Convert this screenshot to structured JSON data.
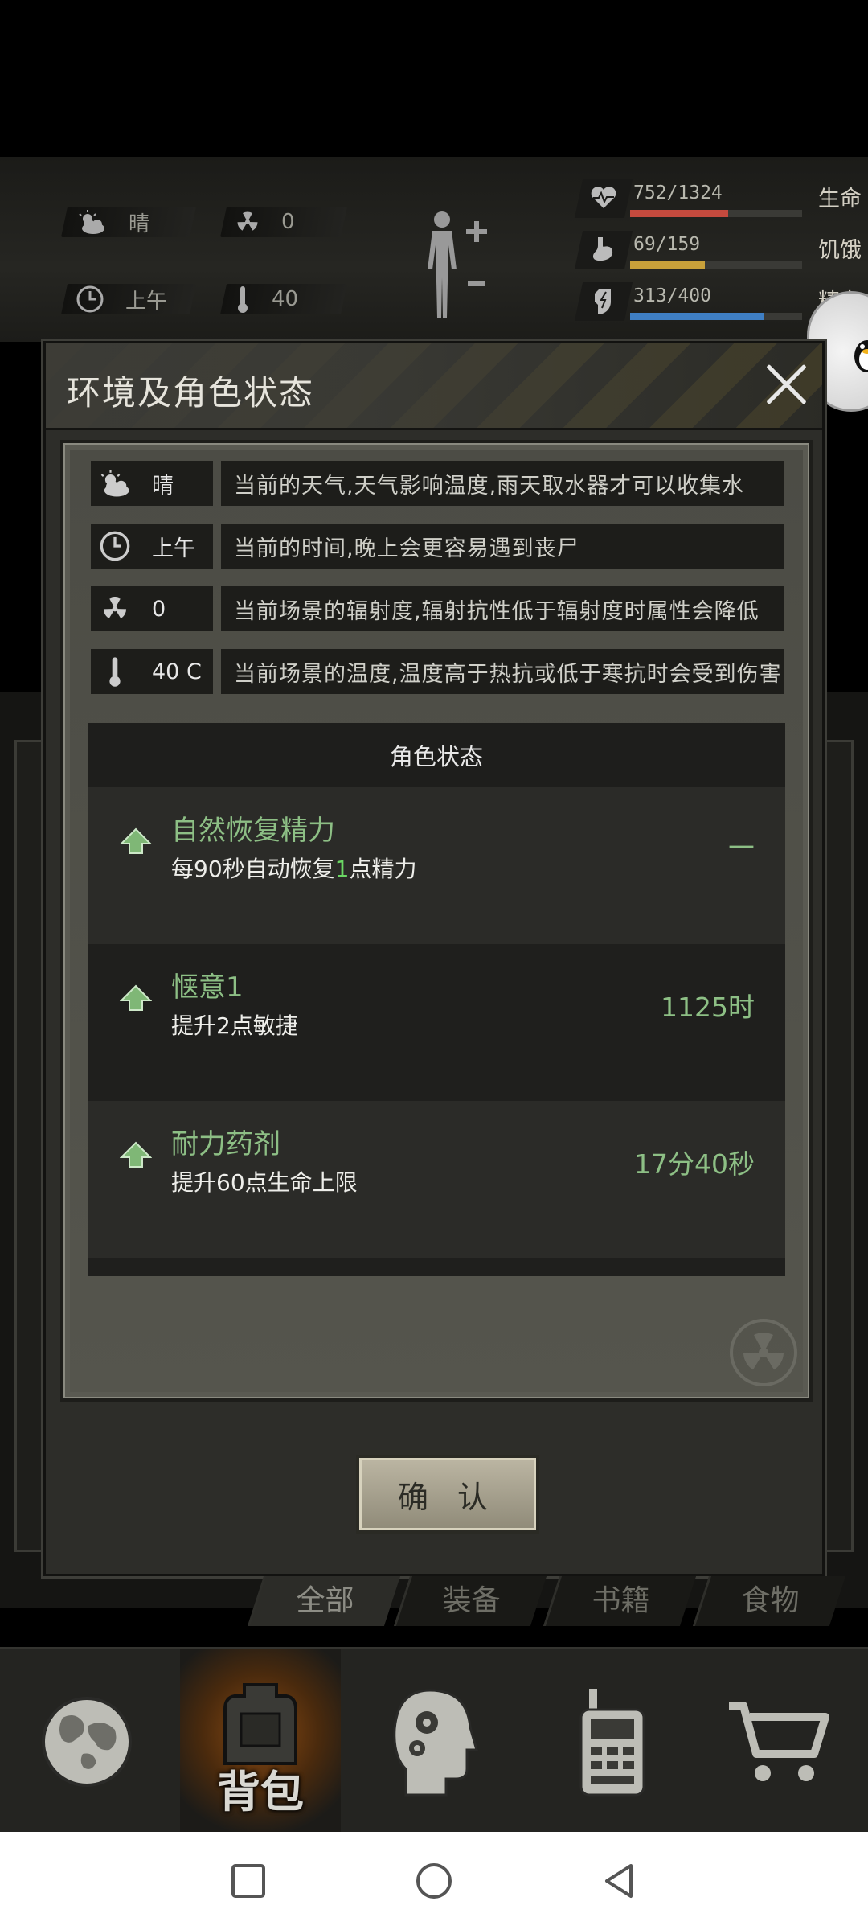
{
  "hud": {
    "weather": "晴",
    "radiation": "0",
    "time": "上午",
    "temperature": "40",
    "stats": [
      {
        "value": "752/1324",
        "label": "生命",
        "fraction": 0.568,
        "color": "#c44a3e"
      },
      {
        "value": "69/159",
        "label": "饥饿",
        "fraction": 0.434,
        "color": "#c9a13a"
      },
      {
        "value": "313/400",
        "label": "精力",
        "fraction": 0.7825,
        "color": "#3f7fc4"
      }
    ]
  },
  "dialog": {
    "title": "环境及角色状态",
    "env_rows": [
      {
        "icon": "sun-cloud-icon",
        "value": "晴",
        "desc": "当前的天气,天气影响温度,雨天取水器才可以收集水"
      },
      {
        "icon": "clock-icon",
        "value": "上午",
        "desc": "当前的时间,晚上会更容易遇到丧尸"
      },
      {
        "icon": "radiation-icon",
        "value": "0",
        "desc": "当前场景的辐射度,辐射抗性低于辐射度时属性会降低"
      },
      {
        "icon": "thermometer-icon",
        "value": "40 C",
        "desc": "当前场景的温度,温度高于热抗或低于寒抗时会受到伤害"
      }
    ],
    "status_header": "角色状态",
    "statuses": [
      {
        "name": "自然恢复精力",
        "desc_before": "每90秒自动恢复",
        "desc_highlight": "1",
        "desc_after": "点精力",
        "duration": "—"
      },
      {
        "name": "惬意1",
        "desc_before": "提升2点敏捷",
        "desc_highlight": "",
        "desc_after": "",
        "duration": "1125时"
      },
      {
        "name": "耐力药剂",
        "desc_before": "提升60点生命上限",
        "desc_highlight": "",
        "desc_after": "",
        "duration": "17分40秒"
      }
    ],
    "confirm_label": "确 认"
  },
  "tabs": [
    "全部",
    "装备",
    "书籍",
    "食物"
  ],
  "bottom_nav": [
    {
      "icon": "globe-icon",
      "label": ""
    },
    {
      "icon": "backpack-icon",
      "label": "背包"
    },
    {
      "icon": "head-gears-icon",
      "label": ""
    },
    {
      "icon": "walkie-talkie-icon",
      "label": ""
    },
    {
      "icon": "shopping-cart-icon",
      "label": ""
    }
  ],
  "colors": {
    "accent_green": "#8dbf85",
    "highlight_green": "#6bd864",
    "hazard_yellow": "#4a4328"
  }
}
